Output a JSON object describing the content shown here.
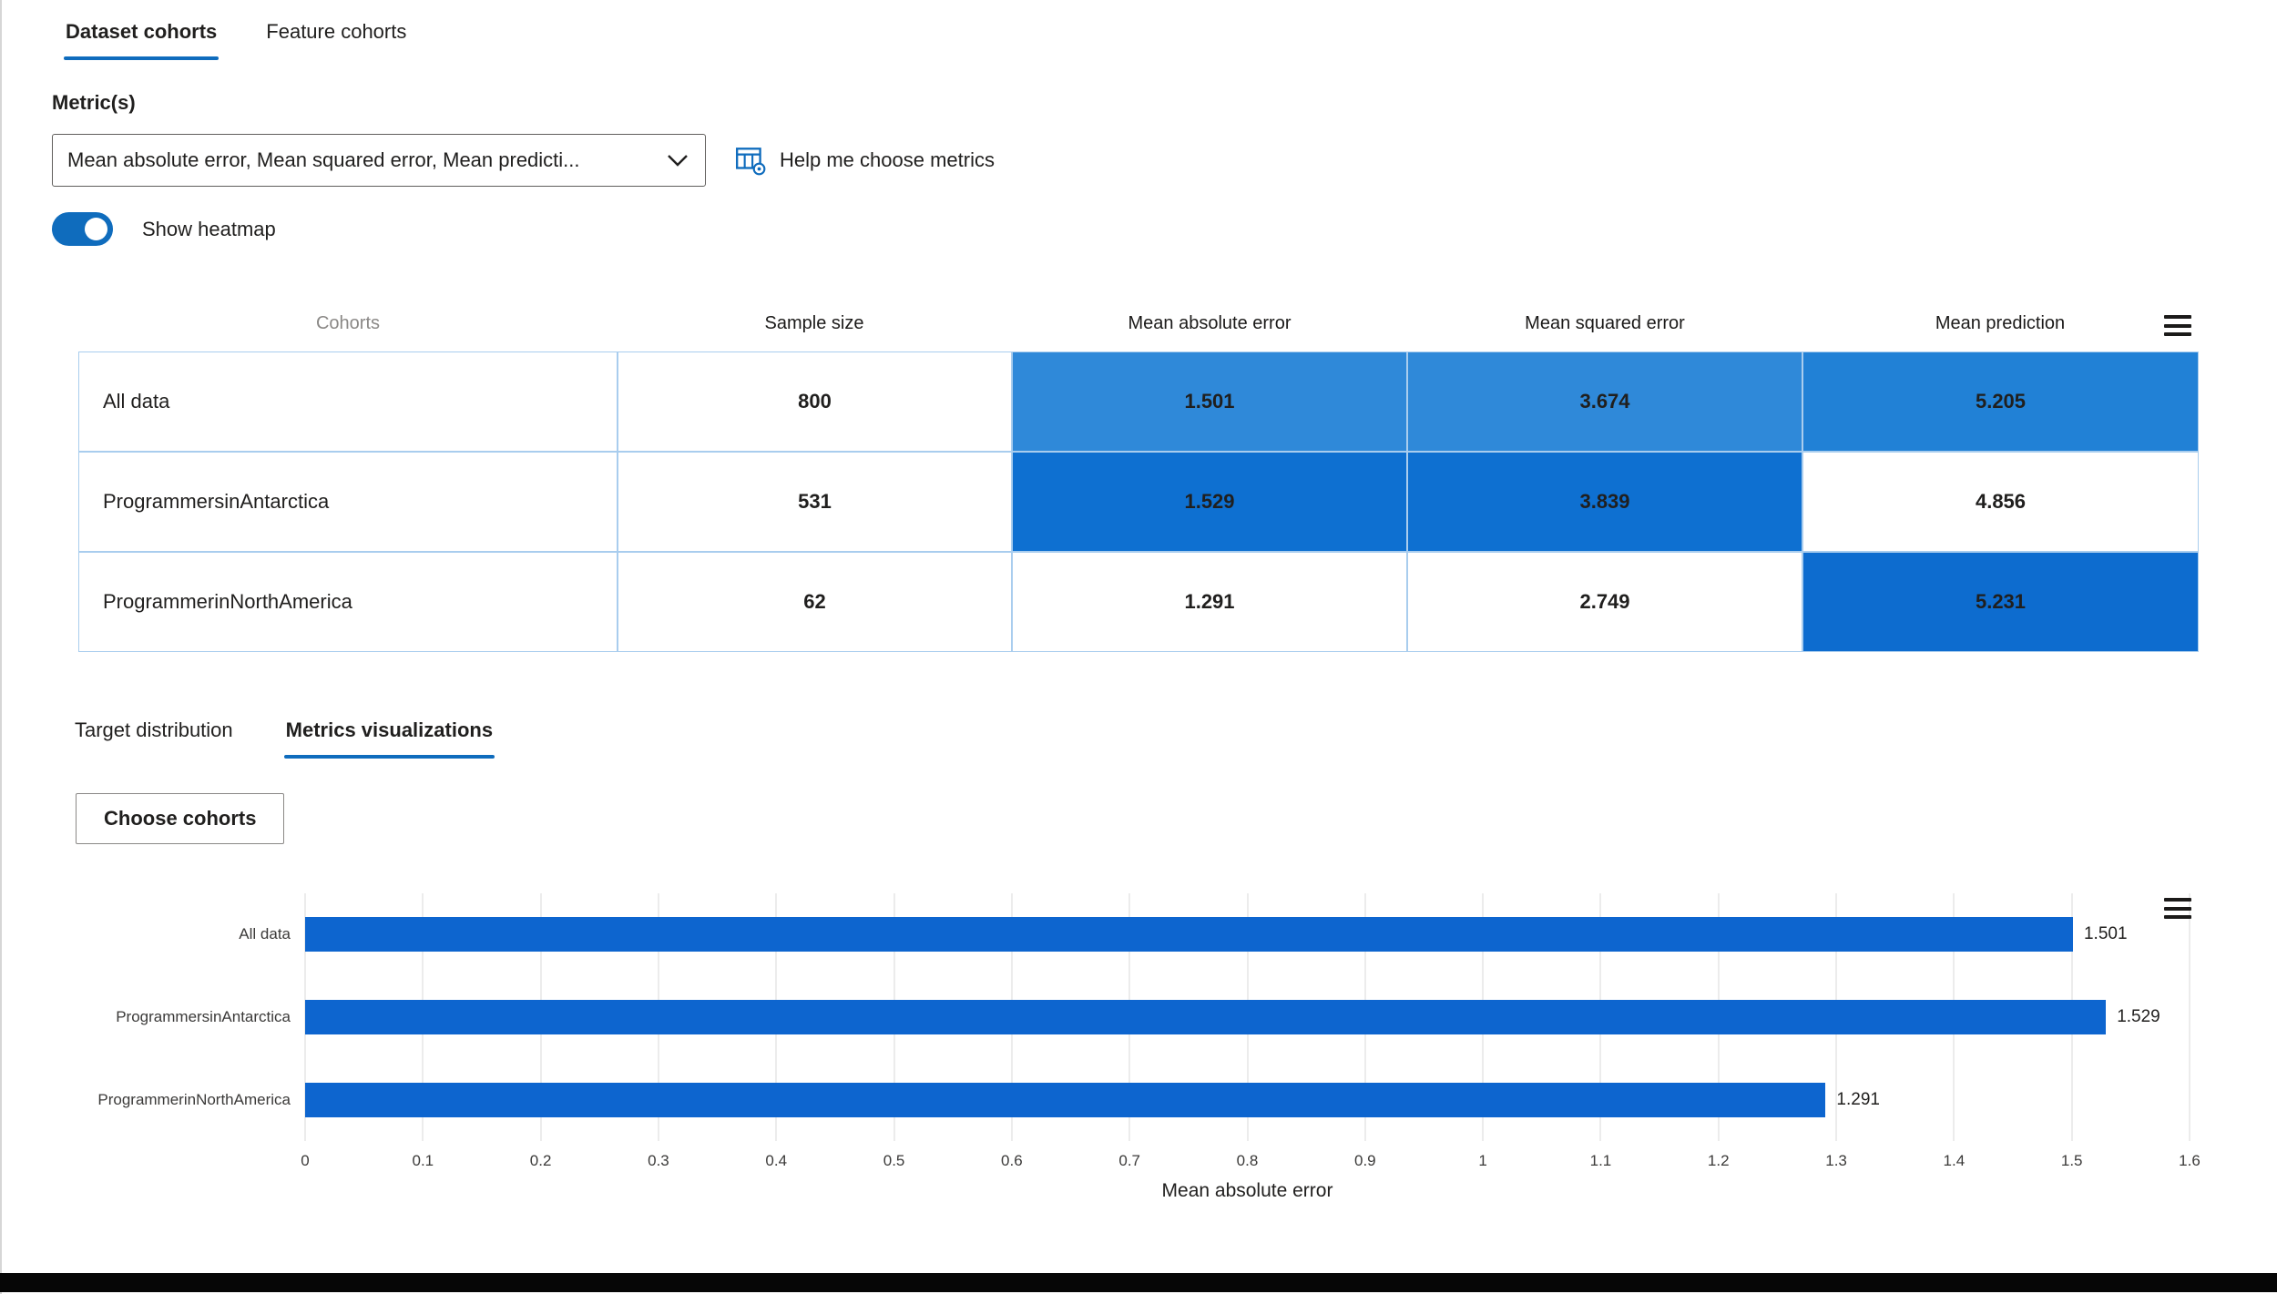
{
  "colors": {
    "accent": "#0f6cbd",
    "bar": "#0d65cf",
    "heatmap_medium": "#2f89d9",
    "heatmap_dark": "#0e70d1",
    "table_border": "#a9cdee"
  },
  "icons": {
    "dropdown": "chevron-down",
    "help": "metrics-table-gear",
    "table_menu": "hamburger-menu",
    "chart_menu": "hamburger-menu"
  },
  "top_tabs": [
    {
      "label": "Dataset cohorts",
      "active": true
    },
    {
      "label": "Feature cohorts",
      "active": false
    }
  ],
  "metric_selector": {
    "label": "Metric(s)",
    "value": "Mean absolute error, Mean squared error, Mean predicti...",
    "help_label": "Help me choose metrics"
  },
  "heatmap_toggle": {
    "label": "Show heatmap",
    "on": true
  },
  "cohort_table": {
    "headers": [
      "Cohorts",
      "Sample size",
      "Mean absolute error",
      "Mean squared error",
      "Mean prediction"
    ],
    "rows": [
      {
        "name": "All data",
        "sample_size": "800",
        "cells": [
          {
            "value": "1.501",
            "bg": "#2f89d9"
          },
          {
            "value": "3.674",
            "bg": "#2f89d9"
          },
          {
            "value": "5.205",
            "bg": "#2181d6"
          }
        ]
      },
      {
        "name": "ProgrammersinAntarctica",
        "sample_size": "531",
        "cells": [
          {
            "value": "1.529",
            "bg": "#0e70d1"
          },
          {
            "value": "3.839",
            "bg": "#0e70d1"
          },
          {
            "value": "4.856",
            "bg": "#ffffff"
          }
        ]
      },
      {
        "name": "ProgrammerinNorthAmerica",
        "sample_size": "62",
        "cells": [
          {
            "value": "1.291",
            "bg": "#ffffff"
          },
          {
            "value": "2.749",
            "bg": "#ffffff"
          },
          {
            "value": "5.231",
            "bg": "#0d6ccf"
          }
        ]
      }
    ]
  },
  "sub_tabs": [
    {
      "label": "Target distribution",
      "active": false
    },
    {
      "label": "Metrics visualizations",
      "active": true
    }
  ],
  "choose_cohorts_label": "Choose cohorts",
  "chart_data": {
    "type": "bar",
    "orientation": "horizontal",
    "categories": [
      "All data",
      "ProgrammersinAntarctica",
      "ProgrammerinNorthAmerica"
    ],
    "values": [
      1.501,
      1.529,
      1.291
    ],
    "value_labels": [
      "1.501",
      "1.529",
      "1.291"
    ],
    "title": "",
    "xlabel": "Mean absolute error",
    "ylabel": "",
    "xlim": [
      0,
      1.6
    ],
    "x_ticks": [
      0,
      0.1,
      0.2,
      0.3,
      0.4,
      0.5,
      0.6,
      0.7,
      0.8,
      0.9,
      1,
      1.1,
      1.2,
      1.3,
      1.4,
      1.5,
      1.6
    ],
    "x_tick_labels": [
      "0",
      "0.1",
      "0.2",
      "0.3",
      "0.4",
      "0.5",
      "0.6",
      "0.7",
      "0.8",
      "0.9",
      "1",
      "1.1",
      "1.2",
      "1.3",
      "1.4",
      "1.5",
      "1.6"
    ],
    "grid": true,
    "legend": false,
    "bar_color": "#0d65cf"
  }
}
